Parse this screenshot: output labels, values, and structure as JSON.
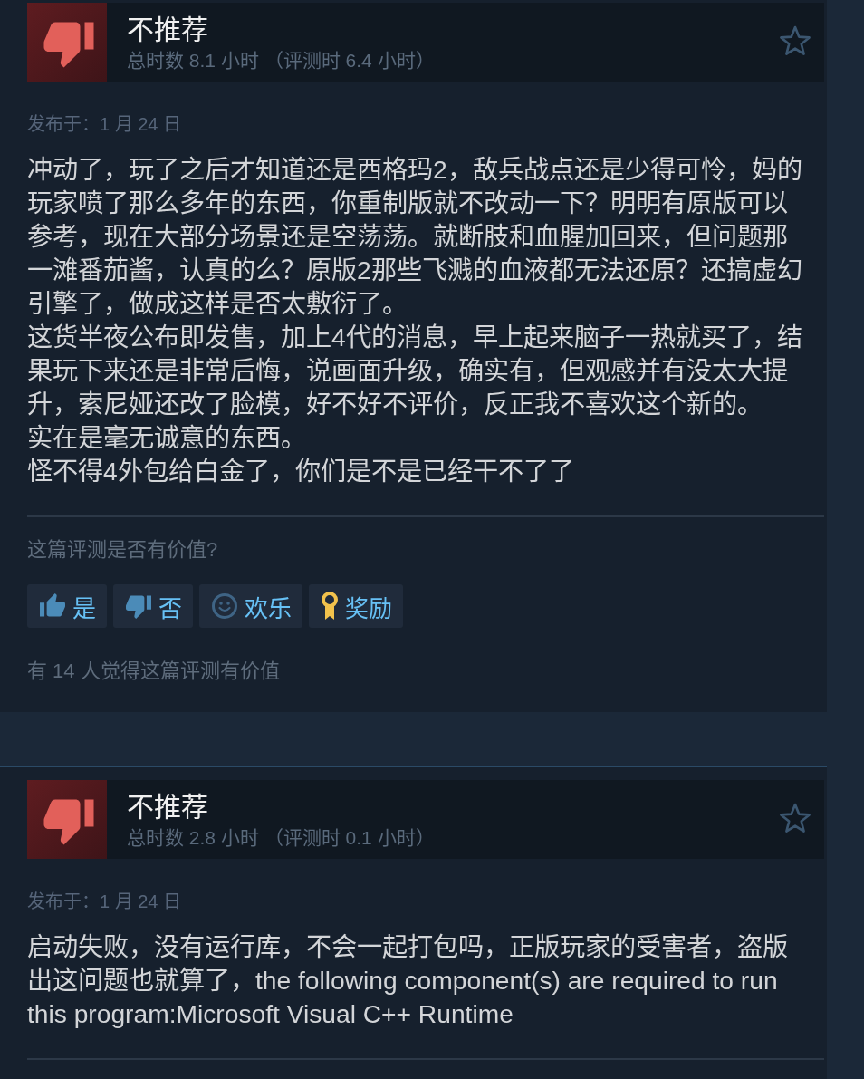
{
  "reviews": [
    {
      "verdict": "不推荐",
      "recommended": false,
      "playtime": "总时数 8.1 小时 （评测时 6.4 小时）",
      "posted": "发布于：1 月 24 日",
      "paragraphs": [
        "冲动了，玩了之后才知道还是西格玛2，敌兵战点还是少得可怜，妈的玩家喷了那么多年的东西，你重制版就不改动一下？明明有原版可以参考，现在大部分场景还是空荡荡。就断肢和血腥加回来，但问题那一滩番茄酱，认真的么？原版2那些飞溅的血液都无法还原？还搞虚幻引擎了，做成这样是否太敷衍了。",
        "这货半夜公布即发售，加上4代的消息，早上起来脑子一热就买了，结果玩下来还是非常后悔，说画面升级，确实有，但观感并有没太大提升，索尼娅还改了脸模，好不好不评价，反正我不喜欢这个新的。",
        "实在是毫无诚意的东西。",
        "怪不得4外包给白金了，你们是不是已经干不了了"
      ],
      "helpful_prompt": "这篇评测是否有价值?",
      "buttons": [
        {
          "kind": "yes",
          "label": "是"
        },
        {
          "kind": "no",
          "label": "否"
        },
        {
          "kind": "funny",
          "label": "欢乐"
        },
        {
          "kind": "award",
          "label": "奖励"
        }
      ],
      "helpful_count": "有 14 人觉得这篇评测有价值"
    },
    {
      "verdict": "不推荐",
      "recommended": false,
      "playtime": "总时数 2.8 小时 （评测时 0.1 小时）",
      "posted": "发布于：1 月 24 日",
      "paragraphs": [
        "启动失败，没有运行库，不会一起打包吗，正版玩家的受害者，盗版出这问题也就算了，the following component(s) are required to run this program:Microsoft Visual C++ Runtime"
      ]
    }
  ]
}
